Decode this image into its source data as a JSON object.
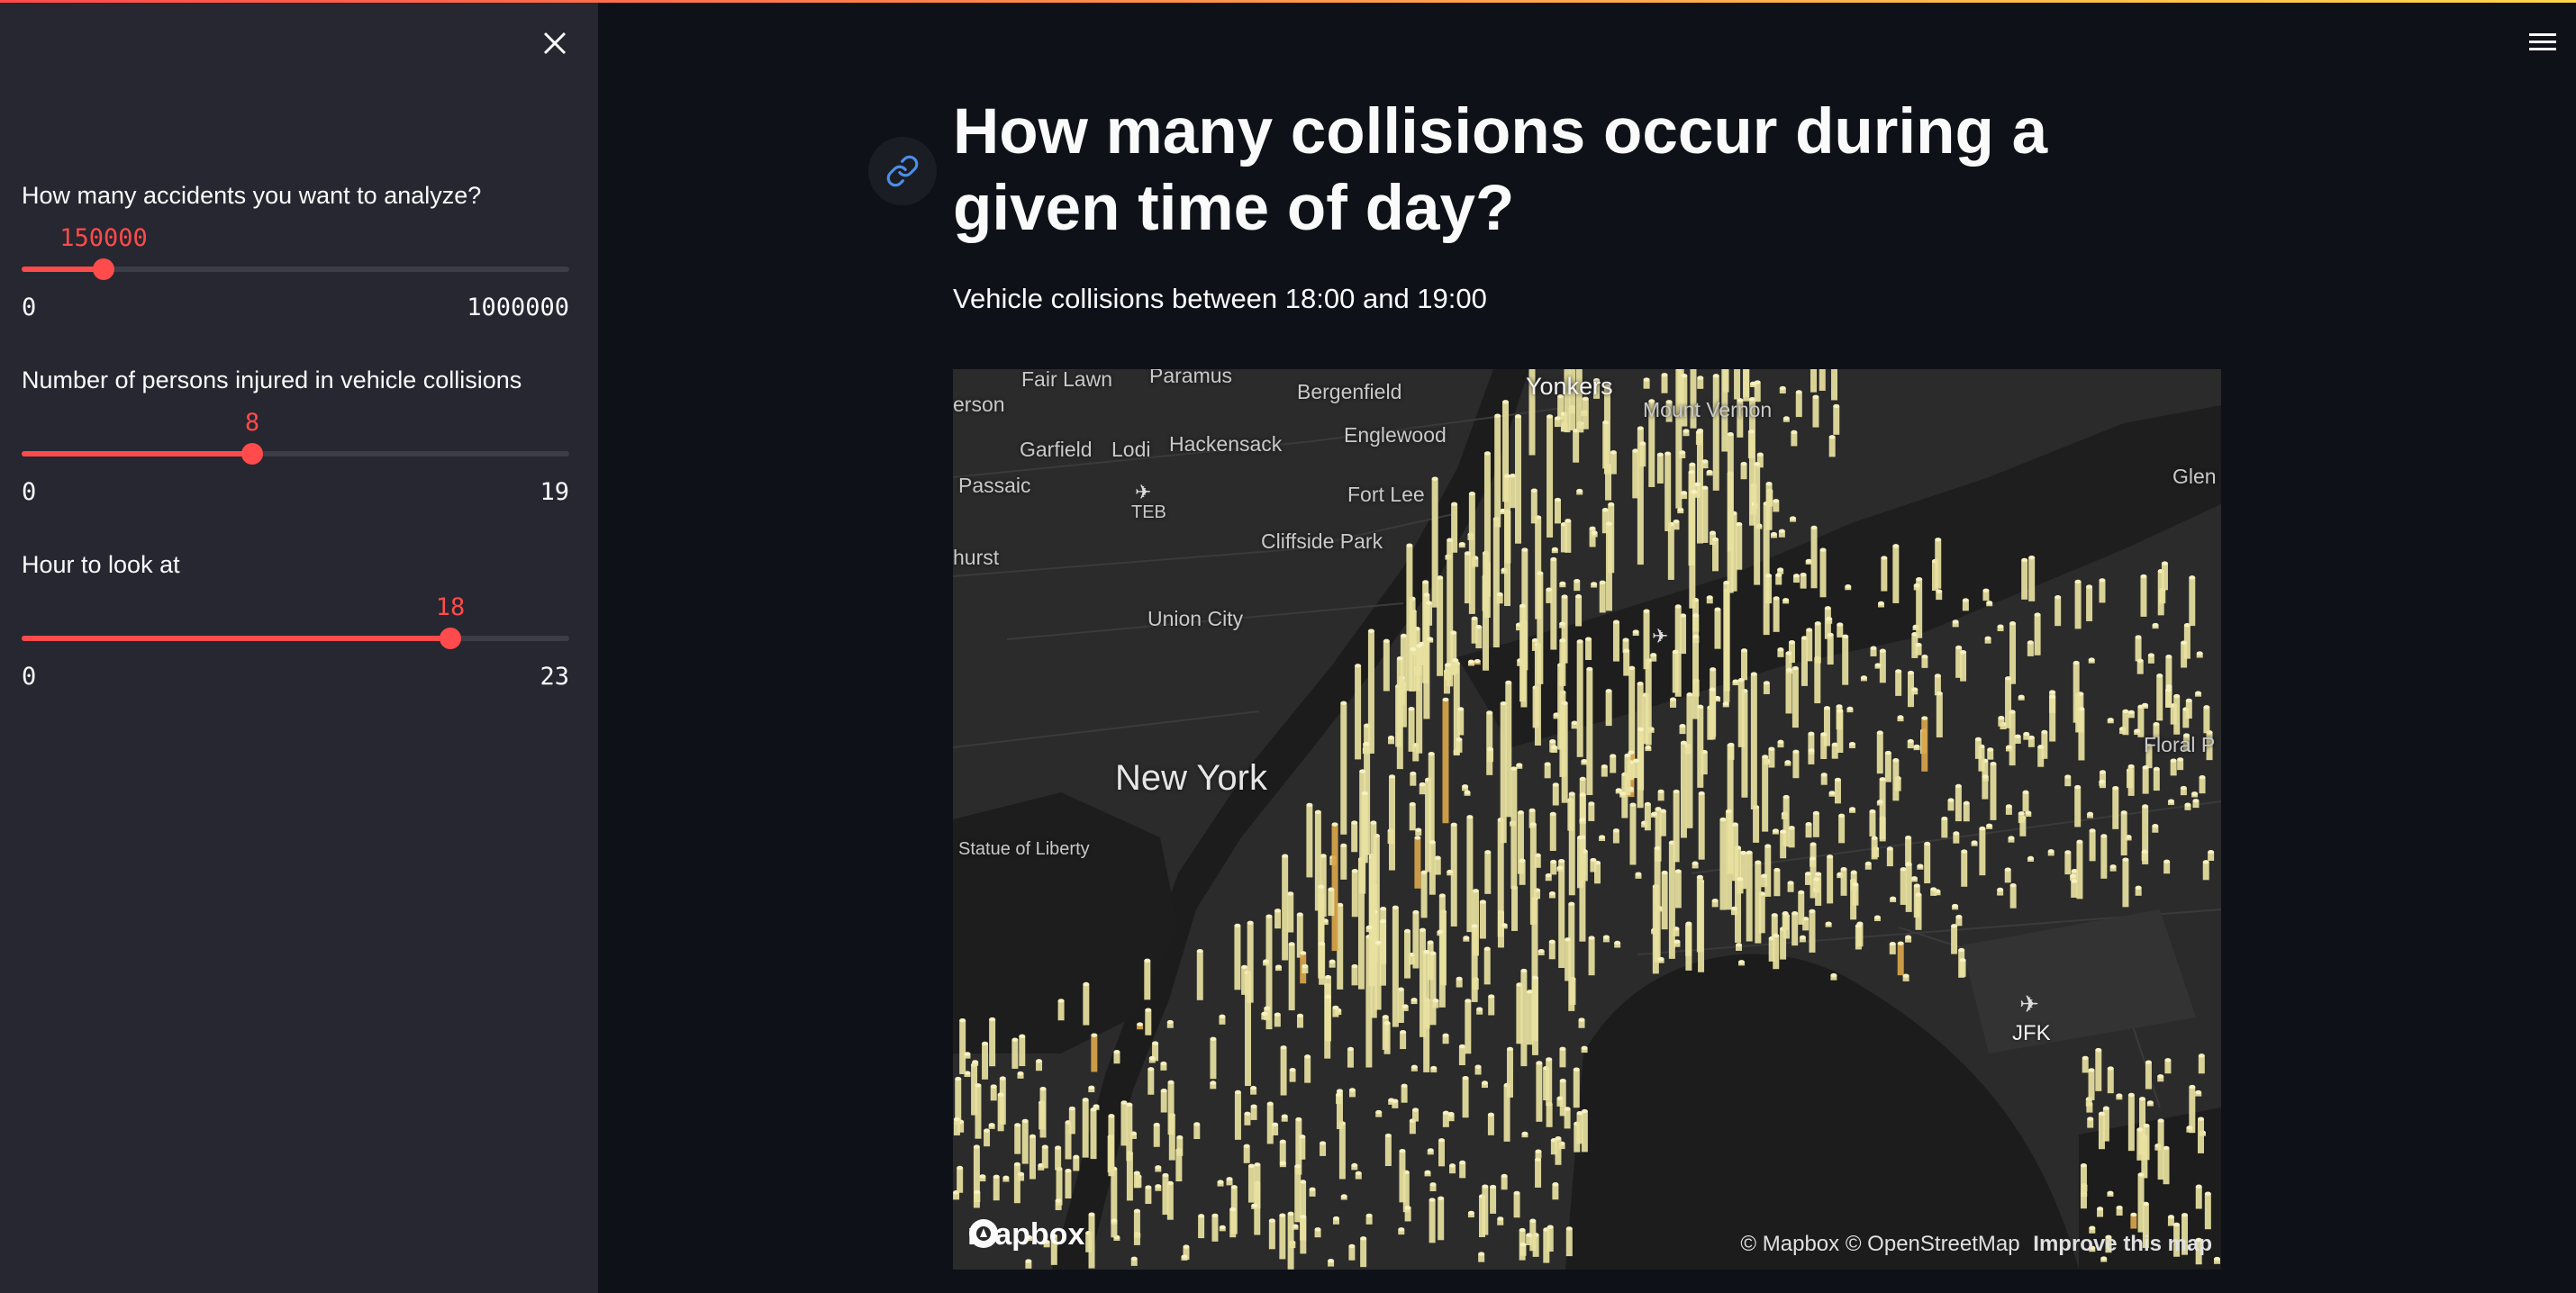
{
  "sidebar": {
    "close_icon": "close-icon",
    "sliders": [
      {
        "label": "How many accidents you want to analyze?",
        "value": "150000",
        "min": "0",
        "max": "1000000",
        "fraction": 0.15
      },
      {
        "label": "Number of persons injured in vehicle collisions",
        "value": "8",
        "min": "0",
        "max": "19",
        "fraction": 0.421
      },
      {
        "label": "Hour to look at",
        "value": "18",
        "min": "0",
        "max": "23",
        "fraction": 0.783
      }
    ]
  },
  "header": {
    "menu_icon": "hamburger-menu-icon"
  },
  "main": {
    "anchor_icon": "link-icon",
    "title": "How many collisions occur during a given time of day?",
    "subtitle": "Vehicle collisions between 18:00 and 19:00"
  },
  "map": {
    "labels": [
      "erson",
      "Fair Lawn",
      "Paramus",
      "Bergenfield",
      "Yonkers",
      "Mount Vernon",
      "Garfield",
      "Lodi",
      "Hackensack",
      "Englewood",
      "Passaic",
      "TEB",
      "Fort Lee",
      "Glen",
      "Cliffside Park",
      "hurst",
      "Union City",
      "New York",
      "Floral P",
      "Statue of Liberty",
      "JFK"
    ],
    "logo_text": "mapbox",
    "attribution": "© Mapbox © OpenStreetMap",
    "improve_link": "Improve this map",
    "colors": {
      "columns": "#e8e1a0",
      "highlight": "#d9a54a",
      "accent": "#ff4b4b"
    }
  }
}
